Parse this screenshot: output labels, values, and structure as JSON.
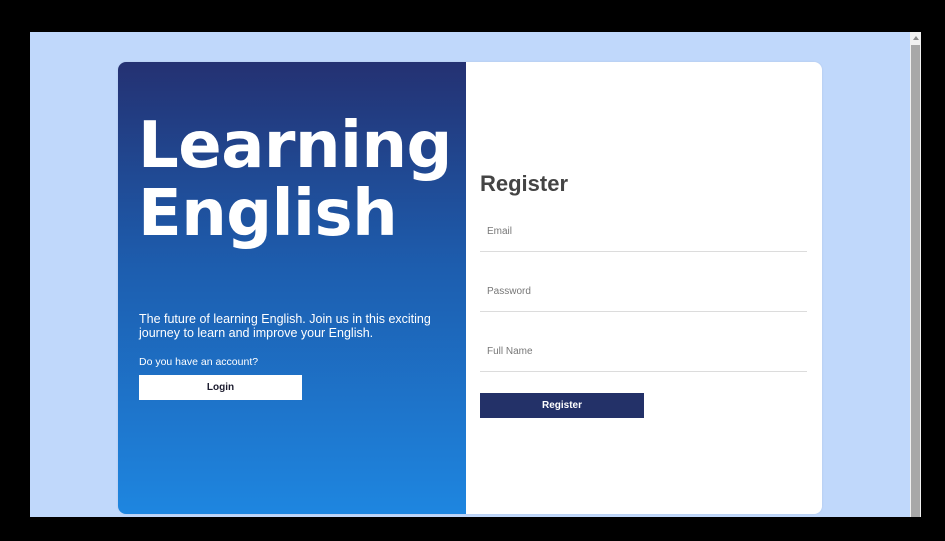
{
  "brand": {
    "line1": "Learning",
    "line2": "English"
  },
  "intro": {
    "tagline": "The future of learning English. Join us in this exciting journey to learn and improve your English.",
    "account_question": "Do you have an account?",
    "login_label": "Login"
  },
  "register_form": {
    "title": "Register",
    "email_placeholder": "Email",
    "password_placeholder": "Password",
    "fullname_placeholder": "Full Name",
    "submit_label": "Register"
  },
  "colors": {
    "page_background": "#c0d8fb",
    "panel_gradient_top": "#243172",
    "panel_gradient_bottom": "#1e86e0",
    "register_button": "#233168"
  }
}
